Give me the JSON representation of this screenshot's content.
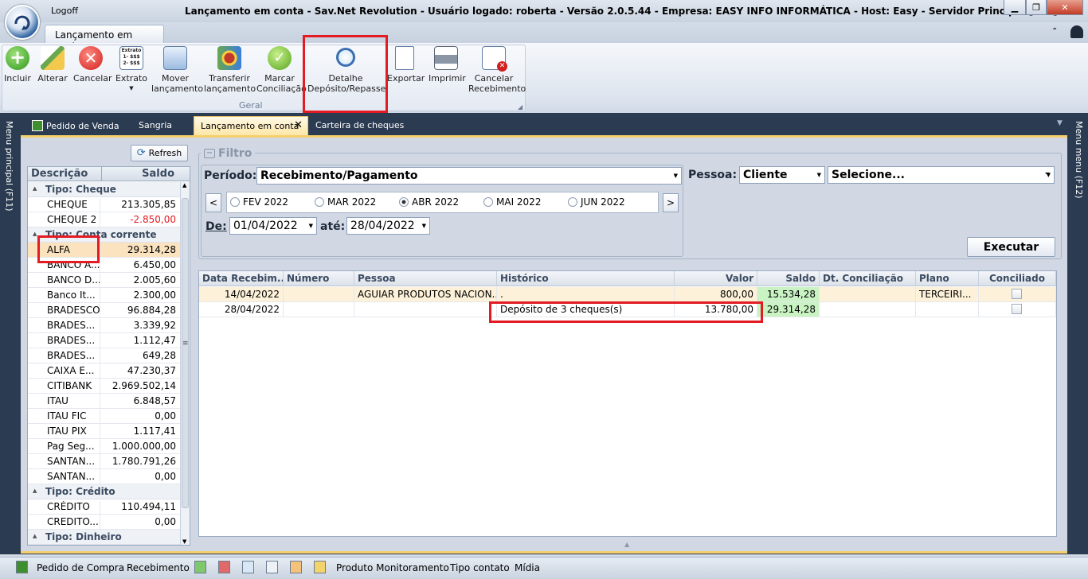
{
  "window": {
    "logoff": "Logoff",
    "title": "Lançamento em conta - Sav.Net Revolution - Usuário logado: roberta - Versão 2.0.5.44 - Empresa: EASY INFO INFORMÁTICA - Host: Easy - Servidor Principal:[SIM]"
  },
  "ribbon": {
    "tab": "Lançamento em conta",
    "group_label": "Geral",
    "buttons": {
      "incluir": "Incluir",
      "alterar": "Alterar",
      "cancelar": "Cancelar",
      "extrato": "Extrato",
      "mover_1": "Mover",
      "mover_2": "lançamento",
      "transferir_1": "Transferir",
      "transferir_2": "lançamento",
      "marcar_1": "Marcar",
      "marcar_2": "Conciliação",
      "detalhe_1": "Detalhe",
      "detalhe_2": "Depósito/Repasse",
      "exportar": "Exportar",
      "imprimir": "Imprimir",
      "cancelar_rec_1": "Cancelar",
      "cancelar_rec_2": "Recebimento"
    },
    "icon_text": {
      "extrato_head": "Extrato",
      "extrato_l1": "1- $$$",
      "extrato_l2": "2- $$$"
    }
  },
  "doc_tabs": [
    "Pedido de Venda",
    "Sangria",
    "Lançamento em conta",
    "Carteira de cheques"
  ],
  "side_labels": {
    "left": "Menu principal (F11)",
    "right": "Menu menu (F12)"
  },
  "accounts": {
    "refresh": "Refresh",
    "col_desc": "Descrição",
    "col_saldo": "Saldo",
    "groups": [
      {
        "name": "Tipo: Cheque",
        "rows": [
          {
            "n": "CHEQUE",
            "v": "213.305,85"
          },
          {
            "n": "CHEQUE 2",
            "v": "-2.850,00",
            "neg": true
          }
        ]
      },
      {
        "name": "Tipo: Conta corrente",
        "rows": [
          {
            "n": "ALFA",
            "v": "29.314,28",
            "sel": true
          },
          {
            "n": "BANCO A...",
            "v": "6.450,00"
          },
          {
            "n": "BANCO D...",
            "v": "2.005,60"
          },
          {
            "n": "Banco It...",
            "v": "2.300,00"
          },
          {
            "n": "BRADESCO",
            "v": "96.884,28"
          },
          {
            "n": "BRADES...",
            "v": "3.339,92"
          },
          {
            "n": "BRADES...",
            "v": "1.112,47"
          },
          {
            "n": "BRADES...",
            "v": "649,28"
          },
          {
            "n": "CAIXA E...",
            "v": "47.230,37"
          },
          {
            "n": "CITIBANK",
            "v": "2.969.502,14"
          },
          {
            "n": "ITAU",
            "v": "6.848,57"
          },
          {
            "n": "ITAU FIC",
            "v": "0,00"
          },
          {
            "n": "ITAU PIX",
            "v": "1.117,41"
          },
          {
            "n": "Pag Seg...",
            "v": "1.000.000,00"
          },
          {
            "n": "SANTAN...",
            "v": "1.780.791,26"
          },
          {
            "n": "SANTAN...",
            "v": "0,00"
          }
        ]
      },
      {
        "name": "Tipo: Crédito",
        "rows": [
          {
            "n": "CRÉDITO",
            "v": "110.494,11"
          },
          {
            "n": "CREDITO...",
            "v": "0,00"
          }
        ]
      },
      {
        "name": "Tipo: Dinheiro",
        "rows": []
      }
    ]
  },
  "filter": {
    "title": "Filtro",
    "periodo_label": "Período:",
    "periodo_value": "Recebimento/Pagamento",
    "months": [
      "FEV 2022",
      "MAR 2022",
      "ABR 2022",
      "MAI 2022",
      "JUN 2022"
    ],
    "selected_month": 2,
    "prev": "<",
    "next": ">",
    "de_label": "De:",
    "de_value": "01/04/2022",
    "ate_label": "até:",
    "ate_value": "28/04/2022",
    "pessoa_label": "Pessoa:",
    "pessoa_type": "Cliente",
    "pessoa_value": "Selecione...",
    "executar": "Executar"
  },
  "grid": {
    "columns": [
      "Data Recebim...",
      "Número",
      "Pessoa",
      "Histórico",
      "Valor",
      "Saldo",
      "Dt. Conciliação",
      "Plano",
      "Conciliado"
    ],
    "rows": [
      [
        "14/04/2022",
        "",
        "AGUIAR PRODUTOS NACION...",
        ".",
        "800,00",
        "15.534,28",
        "",
        "TERCEIRI...",
        ""
      ],
      [
        "28/04/2022",
        "",
        "",
        "Depósito de 3 cheques(s)",
        "13.780,00",
        "29.314,28",
        "",
        "",
        ""
      ]
    ]
  },
  "statusbar": [
    "Pedido de Compra",
    "Recebimento",
    "Produto Monitoramento",
    "Tipo contato",
    "Mídia"
  ],
  "colors": {
    "accent": "#f4cf6b",
    "dark": "#2b3b52",
    "highlight": "#e31b23",
    "saldo_bg": "#c9f3c3",
    "negative": "#e31b23"
  }
}
